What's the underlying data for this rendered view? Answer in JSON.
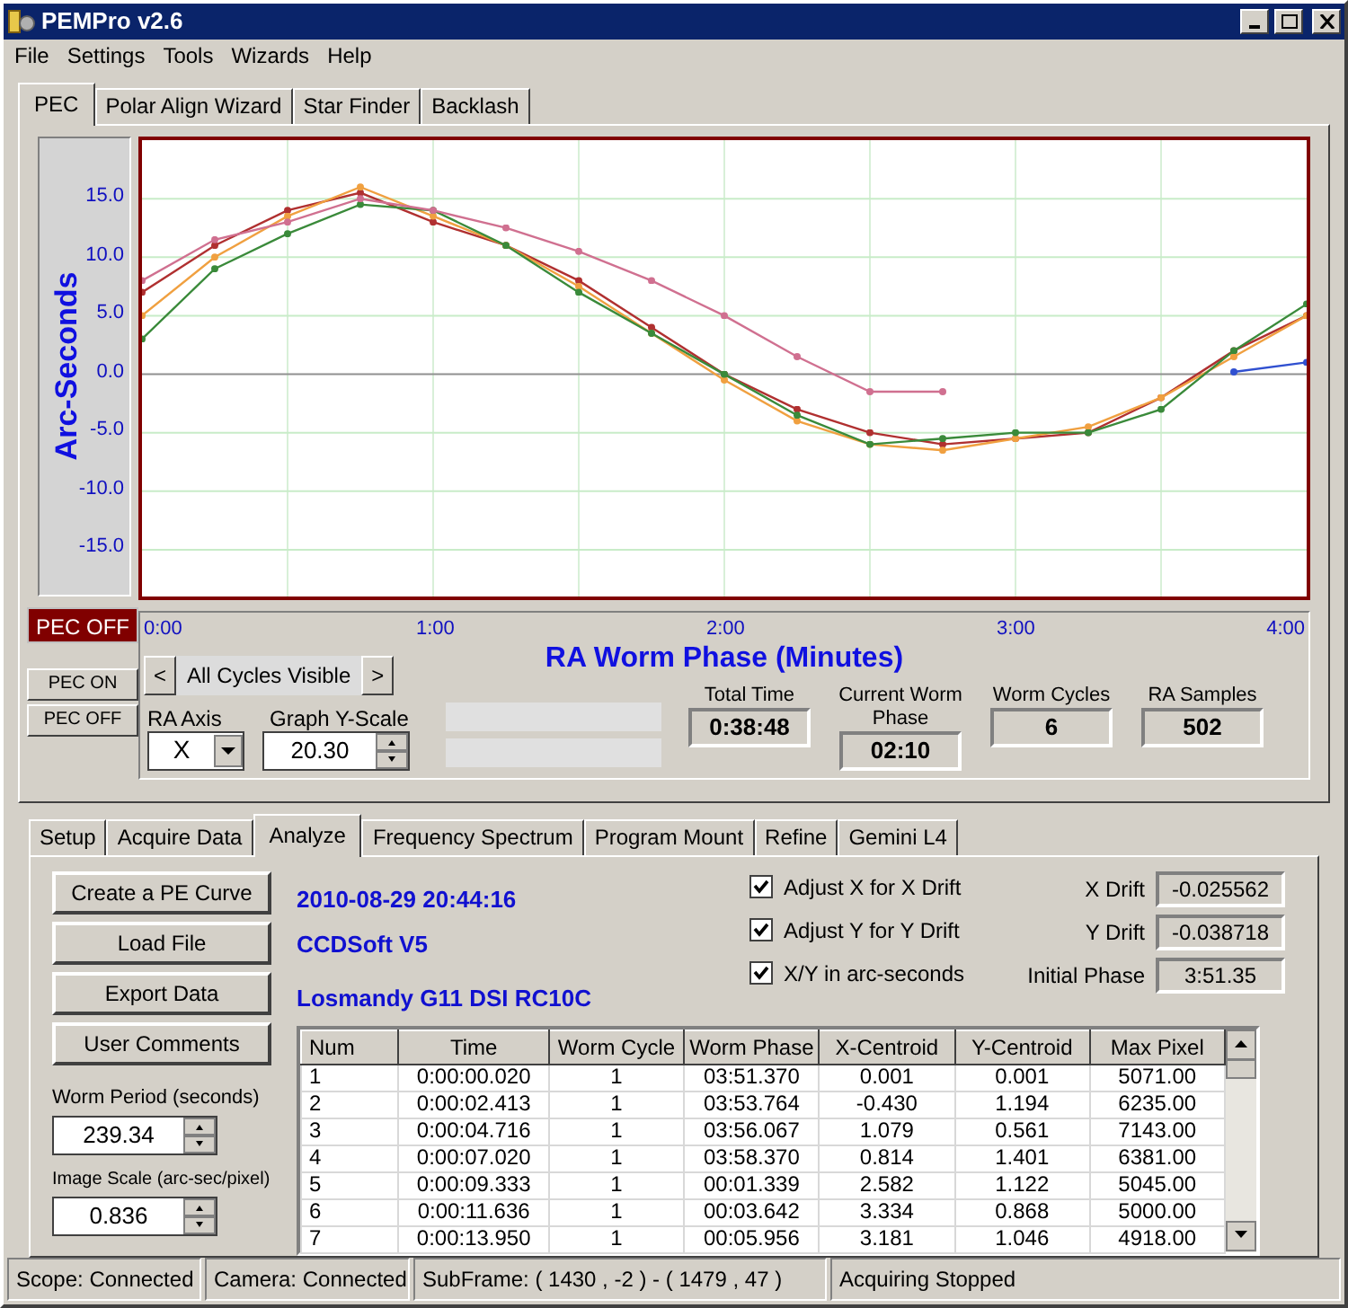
{
  "window": {
    "title": "PEMPro v2.6"
  },
  "menu": [
    "File",
    "Settings",
    "Tools",
    "Wizards",
    "Help"
  ],
  "main_tabs": [
    {
      "label": "PEC",
      "selected": true
    },
    {
      "label": "Polar Align Wizard",
      "selected": false
    },
    {
      "label": "Star Finder",
      "selected": false
    },
    {
      "label": "Backlash",
      "selected": false
    }
  ],
  "chart_data": {
    "type": "line",
    "grid": true,
    "xlabel": "RA Worm Phase (Minutes)",
    "ylabel": "Arc-Seconds",
    "x": [
      0,
      0.25,
      0.5,
      0.75,
      1,
      1.25,
      1.5,
      1.75,
      2,
      2.25,
      2.5,
      2.75,
      3,
      3.25,
      3.5,
      3.75,
      4
    ],
    "xlim": [
      0,
      4
    ],
    "ylim": [
      -19,
      20
    ],
    "xticks": [
      {
        "value": 0,
        "label": "0:00"
      },
      {
        "value": 1,
        "label": "1:00"
      },
      {
        "value": 2,
        "label": "2:00"
      },
      {
        "value": 3,
        "label": "3:00"
      },
      {
        "value": 4,
        "label": "4:00"
      }
    ],
    "yticks": [
      {
        "value": 15,
        "label": "15.0"
      },
      {
        "value": 10,
        "label": "10.0"
      },
      {
        "value": 5,
        "label": "5.0"
      },
      {
        "value": 0,
        "label": "0.0"
      },
      {
        "value": -5,
        "label": "-5.0"
      },
      {
        "value": -10,
        "label": "-10.0"
      },
      {
        "value": -15,
        "label": "-15.0"
      }
    ],
    "series": [
      {
        "color": "#b03030",
        "values": [
          7,
          11,
          14,
          15.5,
          13,
          11,
          8,
          4,
          0,
          -3,
          -5,
          -6,
          -5.5,
          -5,
          -2,
          2,
          5
        ]
      },
      {
        "color": "#f0a040",
        "values": [
          5,
          10,
          13.5,
          16,
          13.5,
          11,
          7.5,
          3.5,
          -0.5,
          -4,
          -6,
          -6.5,
          -5.5,
          -4.5,
          -2,
          1.5,
          5
        ]
      },
      {
        "color": "#3a8a3a",
        "values": [
          3,
          9,
          12,
          14.5,
          14,
          11,
          7,
          3.5,
          0,
          -3.5,
          -6,
          -5.5,
          -5,
          -5,
          -3,
          2,
          6
        ]
      },
      {
        "color": "#d07090",
        "values": [
          8,
          11.5,
          13,
          15,
          14,
          12.5,
          10.5,
          8,
          5,
          1.5,
          -1.5,
          -1.5,
          null,
          null,
          null,
          null,
          null
        ]
      },
      {
        "color": "#3050d0",
        "values": [
          null,
          null,
          null,
          null,
          null,
          null,
          null,
          null,
          null,
          null,
          null,
          null,
          null,
          null,
          null,
          0.2,
          1
        ]
      }
    ]
  },
  "pec_status": "PEC OFF",
  "pec_buttons": [
    "PEC ON",
    "PEC OFF"
  ],
  "cycles": {
    "prev": "<",
    "label": "All Cycles Visible",
    "next": ">"
  },
  "ra_axis": {
    "label": "RA Axis",
    "value": "X"
  },
  "graph_y_scale": {
    "label": "Graph Y-Scale",
    "value": "20.30"
  },
  "stats": [
    {
      "label": "Total Time",
      "value": "0:38:48"
    },
    {
      "label": "Current Worm Phase",
      "value": "02:10"
    },
    {
      "label": "Worm Cycles",
      "value": "6"
    },
    {
      "label": "RA Samples",
      "value": "502"
    }
  ],
  "analysis_tabs": [
    {
      "label": "Setup",
      "selected": false
    },
    {
      "label": "Acquire Data",
      "selected": false
    },
    {
      "label": "Analyze",
      "selected": true
    },
    {
      "label": "Frequency Spectrum",
      "selected": false
    },
    {
      "label": "Program Mount",
      "selected": false
    },
    {
      "label": "Refine",
      "selected": false
    },
    {
      "label": "Gemini L4",
      "selected": false
    }
  ],
  "actions": [
    "Create a PE Curve",
    "Load File",
    "Export Data",
    "User Comments"
  ],
  "worm_period": {
    "label": "Worm Period (seconds)",
    "value": "239.34"
  },
  "image_scale": {
    "label": "Image Scale (arc-sec/pixel)",
    "value": "0.836"
  },
  "info": {
    "timestamp": "2010-08-29 20:44:16",
    "software": "CCDSoft V5",
    "equipment": "Losmandy G11 DSI RC10C"
  },
  "options": [
    {
      "label": "Adjust X for X Drift",
      "checked": true
    },
    {
      "label": "Adjust Y for Y Drift",
      "checked": true
    },
    {
      "label": "X/Y in arc-seconds",
      "checked": true
    }
  ],
  "drifts": [
    {
      "label": "X Drift",
      "value": "-0.025562"
    },
    {
      "label": "Y Drift",
      "value": "-0.038718"
    },
    {
      "label": "Initial Phase",
      "value": "3:51.35"
    }
  ],
  "table": {
    "columns": [
      "Num",
      "Time",
      "Worm Cycle",
      "Worm Phase",
      "X-Centroid",
      "Y-Centroid",
      "Max Pixel"
    ],
    "rows": [
      [
        "1",
        "0:00:00.020",
        "1",
        "03:51.370",
        "0.001",
        "0.001",
        "5071.00"
      ],
      [
        "2",
        "0:00:02.413",
        "1",
        "03:53.764",
        "-0.430",
        "1.194",
        "6235.00"
      ],
      [
        "3",
        "0:00:04.716",
        "1",
        "03:56.067",
        "1.079",
        "0.561",
        "7143.00"
      ],
      [
        "4",
        "0:00:07.020",
        "1",
        "03:58.370",
        "0.814",
        "1.401",
        "6381.00"
      ],
      [
        "5",
        "0:00:09.333",
        "1",
        "00:01.339",
        "2.582",
        "1.122",
        "5045.00"
      ],
      [
        "6",
        "0:00:11.636",
        "1",
        "00:03.642",
        "3.334",
        "0.868",
        "5000.00"
      ],
      [
        "7",
        "0:00:13.950",
        "1",
        "00:05.956",
        "3.181",
        "1.046",
        "4918.00"
      ]
    ]
  },
  "status_bar": [
    "Scope: Connected",
    "Camera: Connected",
    "SubFrame: ( 1430 , -2 ) - ( 1479 , 47 )",
    "Acquiring Stopped"
  ]
}
